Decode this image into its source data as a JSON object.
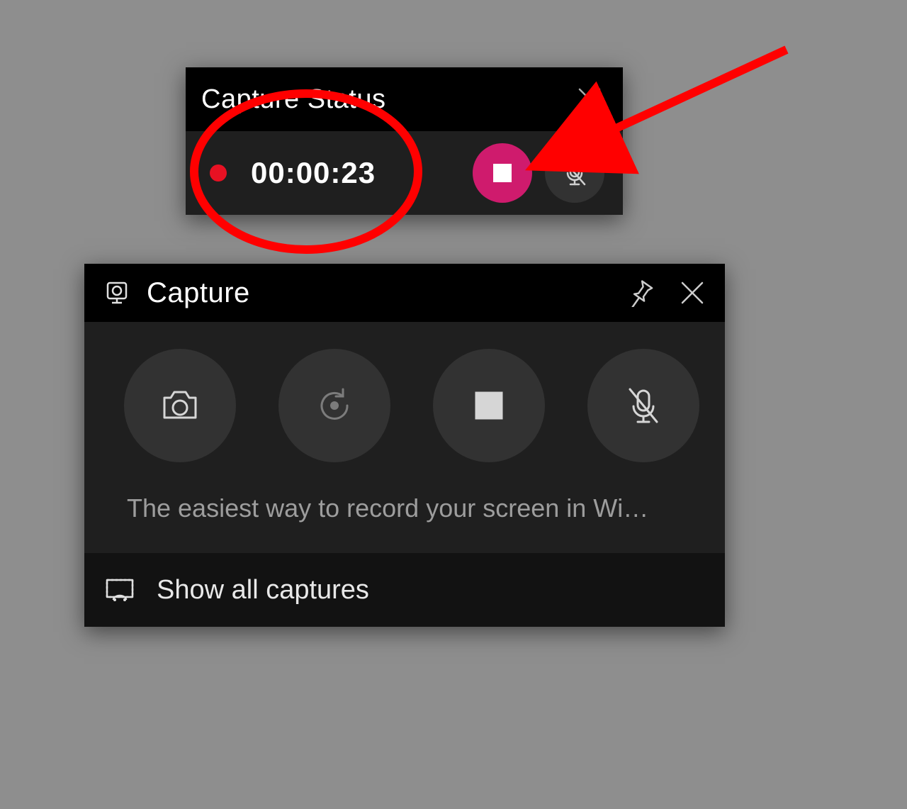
{
  "status_widget": {
    "title": "Capture Status",
    "recording_time": "00:00:23",
    "buttons": {
      "stop_icon": "stop",
      "mic_icon": "mic-muted"
    }
  },
  "capture_panel": {
    "title": "Capture",
    "description": "The easiest way to record your screen in Wi…",
    "buttons": {
      "screenshot_icon": "camera",
      "last30_icon": "record-last-30",
      "stop_icon": "stop",
      "mic_icon": "mic-muted"
    },
    "footer_label": "Show all captures"
  },
  "colors": {
    "accent": "#cf1b6d",
    "record": "#e81123",
    "annotation": "#ff0000"
  }
}
